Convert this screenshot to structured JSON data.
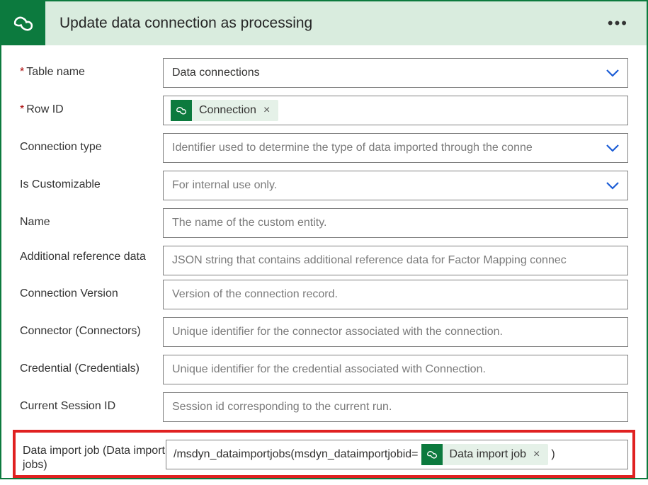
{
  "header": {
    "title": "Update data connection as processing"
  },
  "fields": {
    "table_name": {
      "label": "Table name",
      "value": "Data connections"
    },
    "row_id": {
      "label": "Row ID",
      "token_label": "Connection"
    },
    "connection_type": {
      "label": "Connection type",
      "placeholder": "Identifier used to determine the type of data imported through the conne"
    },
    "is_customizable": {
      "label": "Is Customizable",
      "placeholder": "For internal use only."
    },
    "name": {
      "label": "Name",
      "placeholder": "The name of the custom entity."
    },
    "additional_reference_data": {
      "label": "Additional reference data",
      "placeholder": "JSON string that contains additional reference data for Factor Mapping connec"
    },
    "connection_version": {
      "label": "Connection Version",
      "placeholder": "Version of the connection record."
    },
    "connector": {
      "label": "Connector (Connectors)",
      "placeholder": "Unique identifier for the connector associated with the connection."
    },
    "credential": {
      "label": "Credential (Credentials)",
      "placeholder": "Unique identifier for the credential associated with Connection."
    },
    "current_session_id": {
      "label": "Current Session ID",
      "placeholder": "Session id corresponding to the current run."
    },
    "data_import_job": {
      "label": "Data import job (Data import jobs)",
      "prefix": "/msdyn_dataimportjobs(msdyn_dataimportjobid=",
      "token_label": "Data import job",
      "suffix": ")"
    }
  }
}
